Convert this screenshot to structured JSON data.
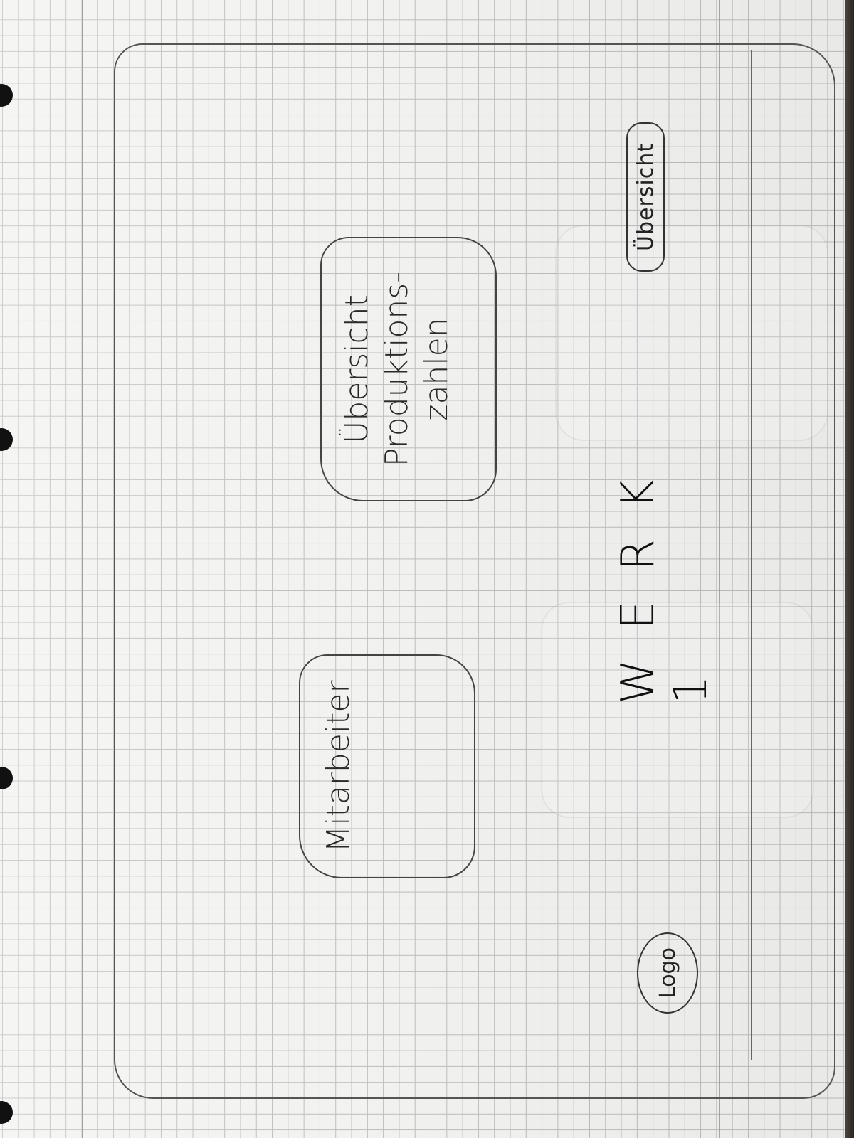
{
  "header": {
    "nav_label": "Übersicht",
    "title": "WERK 1",
    "logo_label": "Logo"
  },
  "cards": {
    "production": {
      "line1": "Übersicht",
      "line2": "Produktions-",
      "line3": "zahlen"
    },
    "employees": {
      "label": "Mitarbeiter"
    }
  }
}
